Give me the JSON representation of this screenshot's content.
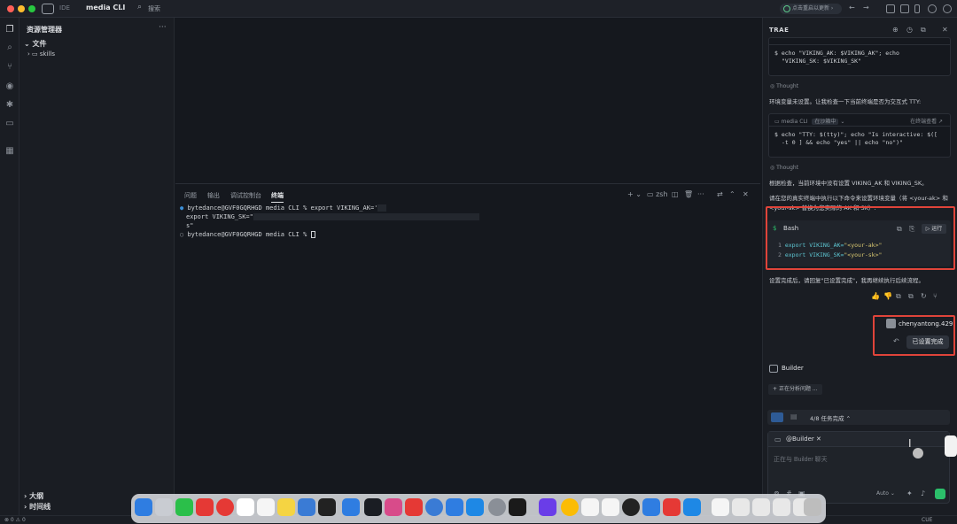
{
  "titlebar": {
    "ide_label": "IDE",
    "project": "media CLI",
    "search": "搜索",
    "update": "点击重启以更新"
  },
  "sidebar": {
    "title": "资源管理器",
    "files": "文件",
    "folder": "skills",
    "outline": "大纲",
    "timeline": "时间线"
  },
  "panel": {
    "tabs": [
      "问题",
      "输出",
      "调试控制台",
      "终端"
    ],
    "shell": "zsh",
    "terminal": {
      "line1": "bytedance@GVF0GQRHGD media CLI % export VIKING_AK='",
      "line2": "export VIKING_SK=\"",
      "line3": "s\"",
      "line4": "bytedance@GVF0GQRHGD media CLI % "
    }
  },
  "chat": {
    "title": "TRAE",
    "block1": {
      "code_line1": "$ echo \"VIKING_AK: $VIKING_AK\"; echo",
      "code_line2": "\"VIKING_SK: $VIKING_SK\""
    },
    "thought": "Thought",
    "msg1": "环境变量未设置。让我检查一下当前终端是否为交互式 TTY:",
    "block2": {
      "name": "media CLI",
      "badge": "在沙箱中",
      "action": "在终端查看 ↗",
      "code_line1": "$ echo \"TTY: $(tty)\"; echo \"Is interactive: $([",
      "code_line2": "-t 0 ] && echo \"yes\" || echo \"no\")\""
    },
    "msg2": "根据检查，当前环境中没有设置 VIKING_AK 和 VIKING_SK。",
    "msg3": "请在您的真实终端中执行以下命令来设置环境变量（将 <your-ak> 和 <your-sk> 替换为您实际的 AK 和 SK）:",
    "bash": {
      "label": "Bash",
      "run": "运行",
      "line1_kw": "export",
      "line1_var": " VIKING_AK=",
      "line1_val": "\"<your-ak>\"",
      "line2_kw": "export",
      "line2_var": " VIKING_SK=",
      "line2_val": "\"<your-sk>\""
    },
    "msg4": "设置完成后，请回复\"已设置完成\"，我再继续执行后续流程。",
    "user": {
      "name": "chenyantong.429",
      "message": "已设置完成"
    },
    "builder": {
      "name": "Builder",
      "status": "正在分析问题 ..."
    },
    "tasks": "4/8 任务完成",
    "input": {
      "mention": "@Builder",
      "placeholder": "正在与 Builder 聊天",
      "model": "Auto"
    }
  },
  "statusbar": {
    "left": "⊗ 0 ⚠ 0",
    "right": "CUE"
  },
  "colors": {
    "accent_red": "#e0443a",
    "send_green": "#2bbf6a"
  }
}
